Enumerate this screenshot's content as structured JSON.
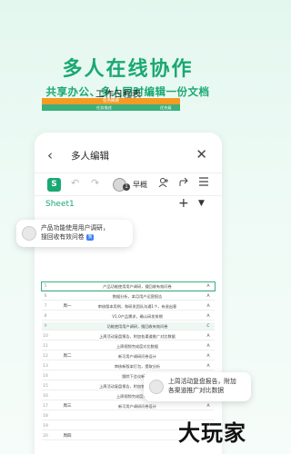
{
  "hero": {
    "title": "多人在线协作",
    "subtitle": "共享办公、多人同时编辑一份文档"
  },
  "nav": {
    "back_icon": "‹",
    "title": "多人编辑",
    "close_icon": "✕"
  },
  "toolbar": {
    "s_label": "S",
    "undo": "↶",
    "redo": "↷",
    "avatar_badge": "1",
    "user_name": "早概"
  },
  "sheet_tab": {
    "name": "Sheet1",
    "add": "+",
    "caret": "▼"
  },
  "schedule": {
    "title": "工作日程表",
    "header": "任务摘要",
    "col_task": "任务描述",
    "col_level": "优先级"
  },
  "rows": [
    {
      "n": "5",
      "week": "",
      "task": "产品功能使用用户调研，搜回收有效问卷",
      "level": "A"
    },
    {
      "n": "6",
      "week": "",
      "task": "数据分析，本月用户运营报告",
      "level": "A"
    },
    {
      "n": "7",
      "week": "周一",
      "task": "审核版本用例，和研发团队沟通1个，有退出意",
      "level": "A"
    },
    {
      "n": "8",
      "week": "",
      "task": "V1.0产品需求，确认研发排期",
      "level": "A"
    },
    {
      "n": "9",
      "week": "",
      "task": "功能使用用户调研，搜回收有效问卷",
      "level": "C"
    },
    {
      "n": "10",
      "week": "",
      "task": "上周活动复盘报告，附加各渠道推广对比数据",
      "level": "A"
    },
    {
      "n": "11",
      "week": "",
      "task": "上周视频完成度对比数据",
      "level": "A"
    },
    {
      "n": "12",
      "week": "周二",
      "task": "新可用户调研问卷设计",
      "level": "A"
    },
    {
      "n": "13",
      "week": "",
      "task": "审核新版本打包，提取分析",
      "level": "A"
    },
    {
      "n": "14",
      "week": "",
      "task": "跟踪下会议新功能",
      "level": "A"
    },
    {
      "n": "15",
      "week": "",
      "task": "上周活动复盘报告，附加各渠道推广对比数据",
      "level": "A"
    },
    {
      "n": "16",
      "week": "",
      "task": "上周视频完成度对比数据",
      "level": "A"
    },
    {
      "n": "17",
      "week": "周三",
      "task": "新可用户调研问卷设计",
      "level": "A"
    },
    {
      "n": "18",
      "week": "",
      "task": "",
      "level": ""
    },
    {
      "n": "19",
      "week": "",
      "task": "",
      "level": ""
    },
    {
      "n": "20",
      "week": "周四",
      "task": "",
      "level": ""
    }
  ],
  "bubble_left": {
    "line1": "产品功能使用用户调研，",
    "line2": "搜回收有效问卷",
    "tag": "我"
  },
  "bubble_right": {
    "line1": "上周活动复盘报告，附加",
    "line2": "各渠道推广对比数据"
  },
  "watermark": "大玩家"
}
